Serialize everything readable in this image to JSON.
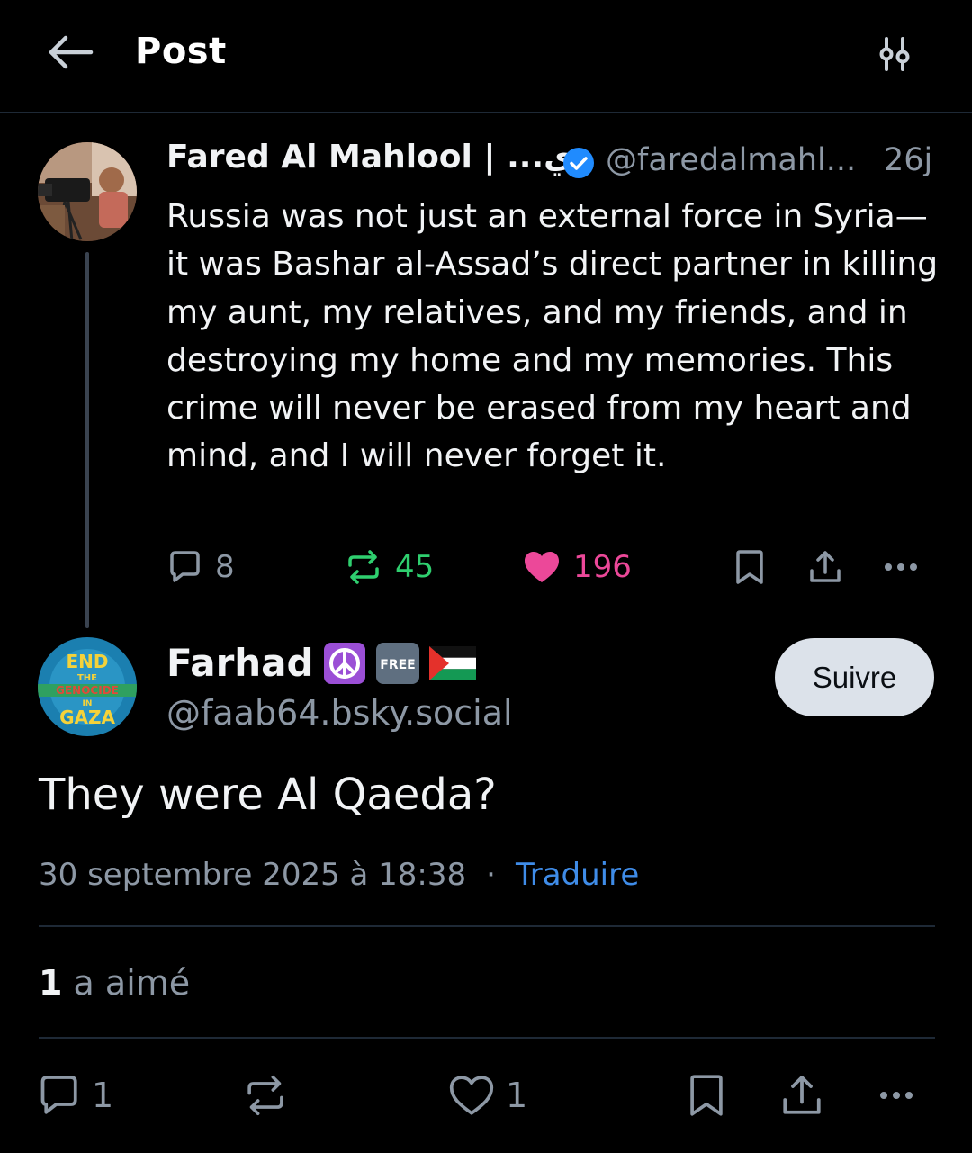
{
  "header": {
    "title": "Post"
  },
  "parent_post": {
    "author_name": "Fared Al Mahlool | ...ري",
    "handle": "@faredalmahl...",
    "time": "26j",
    "body": "Russia was not just an external force in Syria—it was Bashar al-Assad’s direct partner in killing my aunt, my relatives, and my friends, and in destroying my home and my memories. This crime will never be erased from my heart and mind, and I will never forget it.",
    "replies": "8",
    "reposts": "45",
    "likes": "196",
    "colors": {
      "repost": "#2fcf6f",
      "like": "#ec4899",
      "muted": "#8d98a5"
    }
  },
  "main_post": {
    "author_name": "Farhad",
    "emoji_free_label": "FREE",
    "handle": "@faab64.bsky.social",
    "follow_label": "Suivre",
    "body": "They were Al Qaeda?",
    "timestamp": "30 septembre 2025 à 18:38",
    "separator": "·",
    "translate_label": "Traduire",
    "likes_count": "1",
    "likes_label": "a aimé",
    "replies": "1",
    "likes": "1",
    "avatar_text": {
      "line1": "END",
      "line2": "THE",
      "line3": "GENOCIDE",
      "line4": "IN",
      "line5": "GAZA"
    },
    "colors": {
      "link": "#3f8ce8",
      "follow_bg": "#dce2ea"
    }
  }
}
